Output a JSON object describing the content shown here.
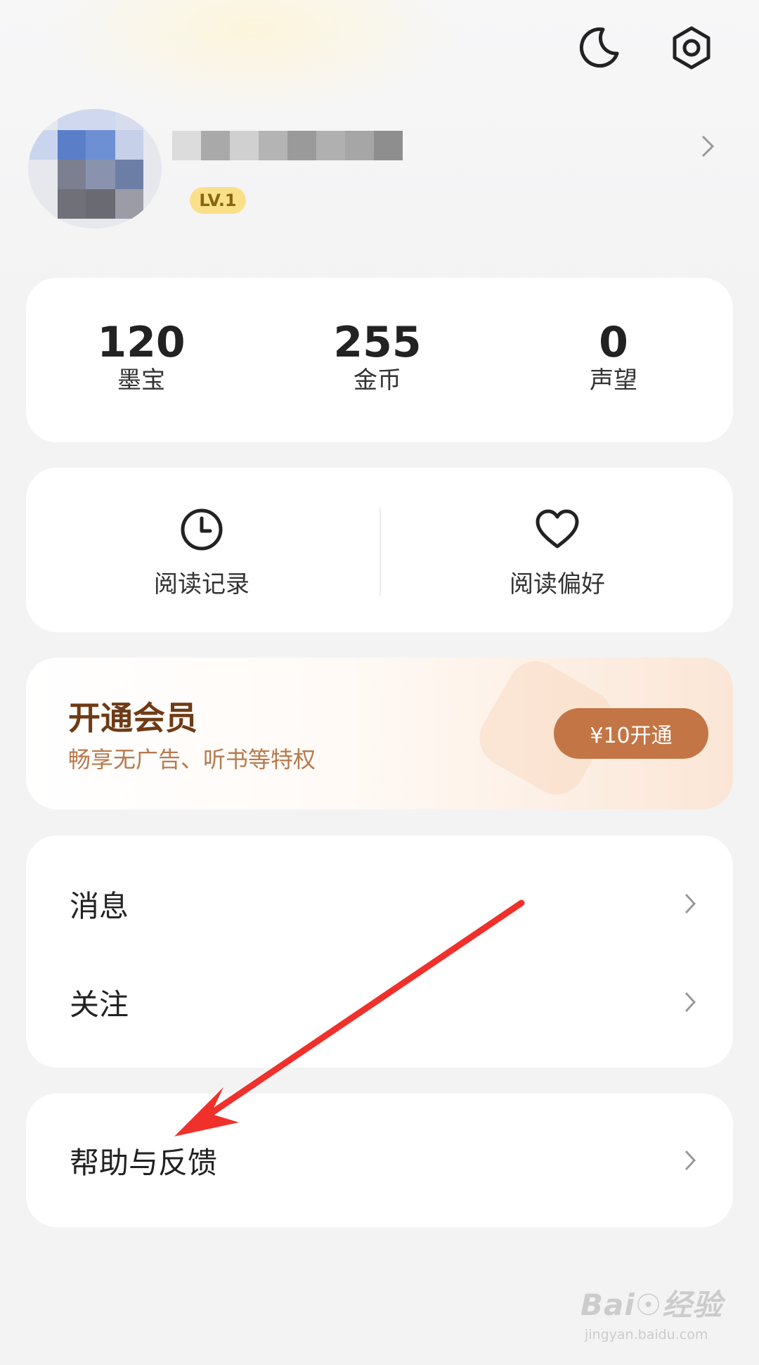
{
  "header": {
    "night_mode_icon": "moon-icon",
    "settings_icon": "gear-icon"
  },
  "profile": {
    "level": "LV.1"
  },
  "stats": [
    {
      "value": "120",
      "label": "墨宝"
    },
    {
      "value": "255",
      "label": "金币"
    },
    {
      "value": "0",
      "label": "声望"
    }
  ],
  "reading": {
    "history_label": "阅读记录",
    "history_icon": "clock-icon",
    "preference_label": "阅读偏好",
    "preference_icon": "heart-icon"
  },
  "vip": {
    "title": "开通会员",
    "subtitle": "畅享无广告、听书等特权",
    "button_label": "¥10开通",
    "button_color": "#c37545"
  },
  "menu": {
    "messages_label": "消息",
    "follow_label": "关注",
    "help_label": "帮助与反馈"
  },
  "annotation": {
    "arrow_color": "#f0302b"
  },
  "watermark": {
    "brand": "Bai☉经验",
    "url": "jingyan.baidu.com"
  }
}
